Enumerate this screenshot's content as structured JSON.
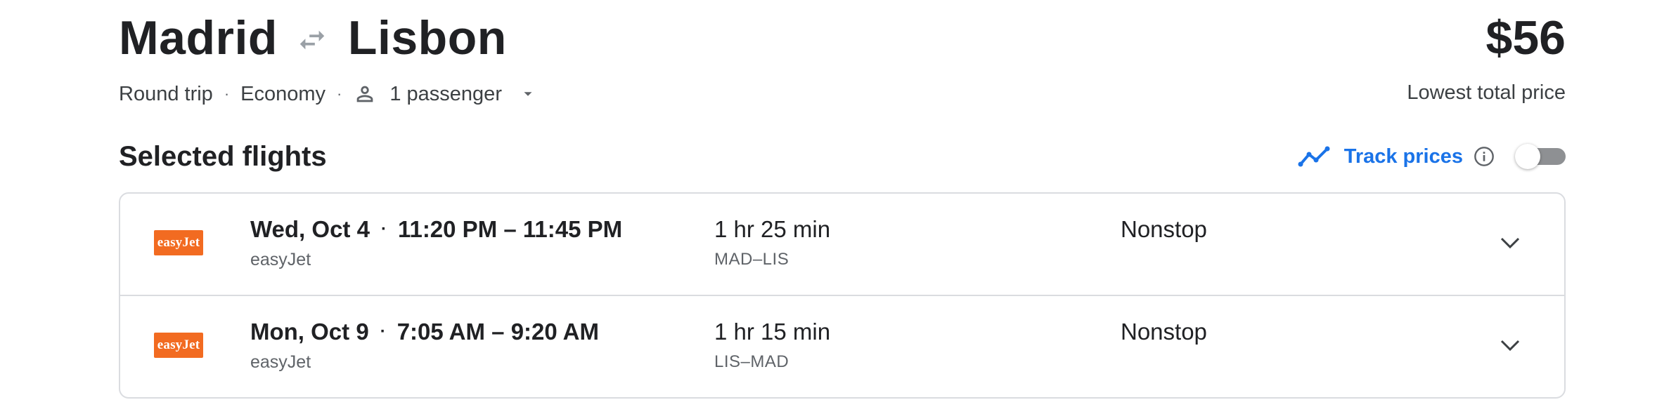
{
  "header": {
    "origin": "Madrid",
    "destination": "Lisbon",
    "price": "$56",
    "price_label": "Lowest total price",
    "trip_type": "Round trip",
    "cabin": "Economy",
    "passengers": "1 passenger",
    "separator": "·"
  },
  "section": {
    "title": "Selected flights",
    "track_prices_label": "Track prices",
    "track_prices_on": false
  },
  "flights": [
    {
      "logo_text": "easyJet",
      "date": "Wed, Oct 4",
      "time_range": "11:20 PM – 11:45 PM",
      "airline": "easyJet",
      "duration": "1 hr 25 min",
      "route_codes": "MAD–LIS",
      "stops": "Nonstop"
    },
    {
      "logo_text": "easyJet",
      "date": "Mon, Oct 9",
      "time_range": "7:05 AM – 9:20 AM",
      "airline": "easyJet",
      "duration": "1 hr 15 min",
      "route_codes": "LIS–MAD",
      "stops": "Nonstop"
    }
  ],
  "colors": {
    "accent": "#1a73e8",
    "easyjet_orange": "#f26b21",
    "border": "#dadce0",
    "text_primary": "#202124",
    "text_secondary": "#5f6368"
  },
  "icons": {
    "swap": "swap-arrows-icon",
    "person": "person-icon",
    "caret": "caret-down-icon",
    "trend": "trend-line-icon",
    "info": "info-icon",
    "expand": "chevron-down-icon"
  }
}
